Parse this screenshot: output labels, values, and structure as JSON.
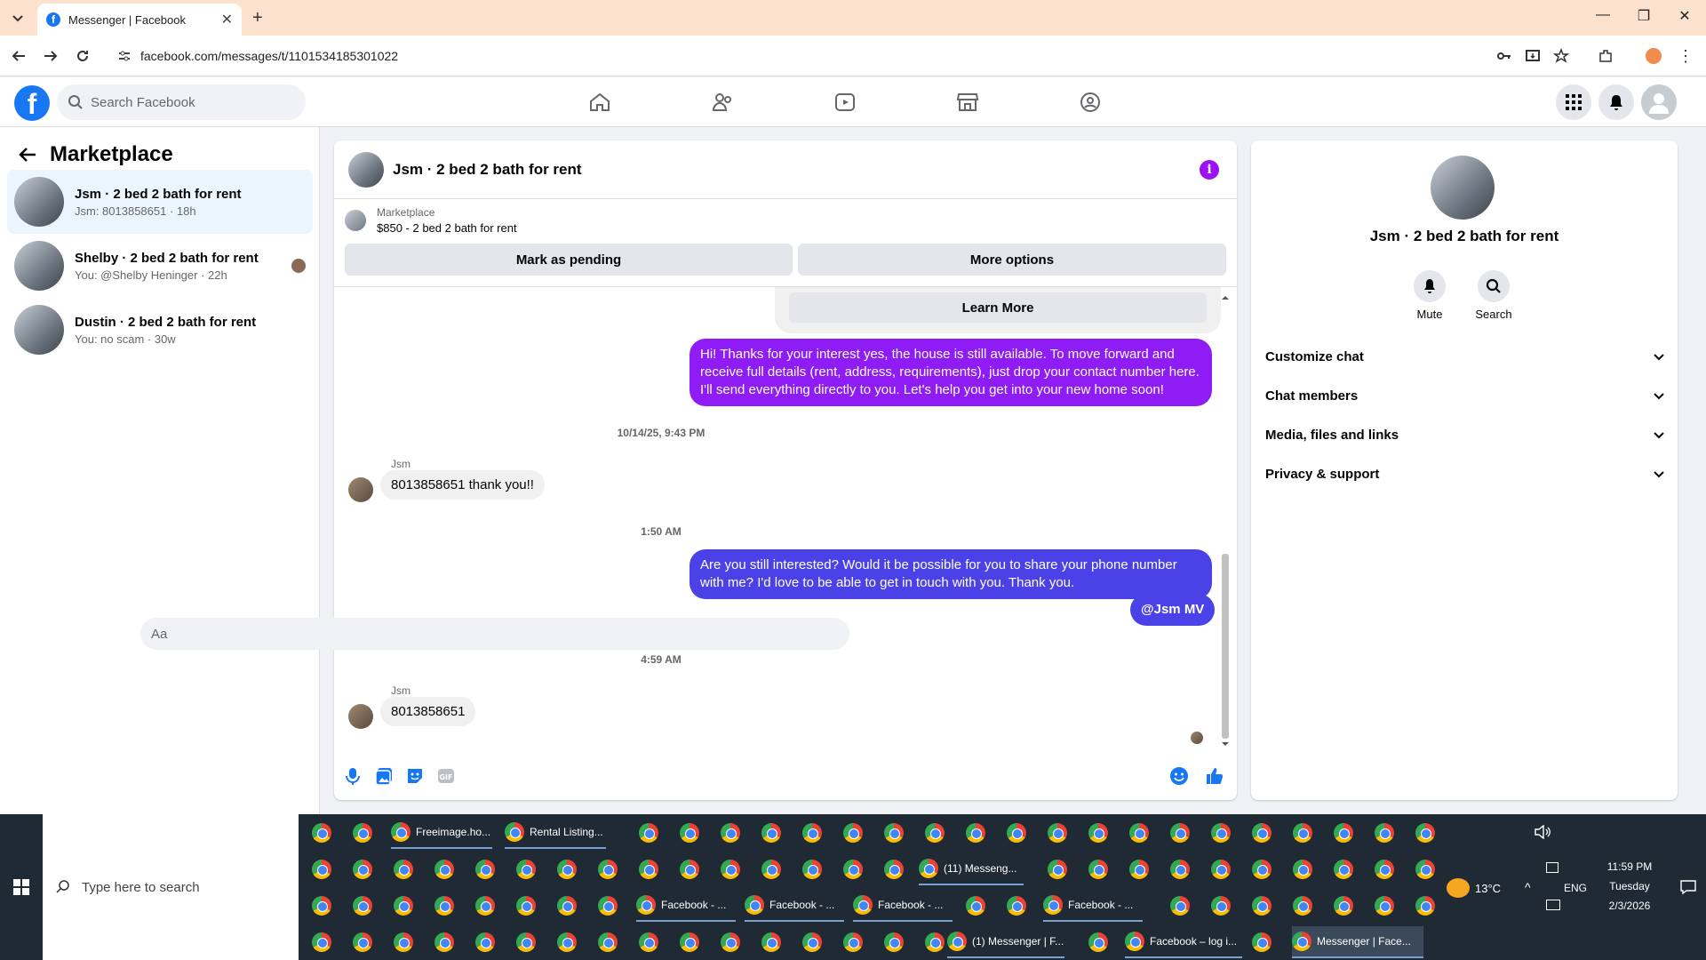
{
  "browser": {
    "tab_title": "Messenger | Facebook",
    "url": "facebook.com/messages/t/1101534185301022"
  },
  "fb": {
    "search_placeholder": "Search Facebook"
  },
  "left": {
    "title": "Marketplace",
    "conversations": [
      {
        "name": "Jsm · 2 bed 2 bath for rent",
        "sub": "Jsm: 8013858651 · 18h"
      },
      {
        "name": "Shelby · 2 bed 2 bath for rent",
        "sub": "You: @Shelby Heninger · 22h"
      },
      {
        "name": "Dustin · 2 bed 2 bath for rent",
        "sub": "You: no scam · 30w"
      }
    ]
  },
  "chat": {
    "title": "Jsm · 2 bed 2 bath for rent",
    "marketplace_label": "Marketplace",
    "listing": "$850 - 2 bed 2 bath for rent",
    "mark_pending": "Mark as pending",
    "more_options": "More options",
    "learn_more": "Learn More",
    "messages": {
      "out1": "Hi! Thanks for your interest yes, the house is still available. To move forward and receive full details (rent, address, requirements), just drop your contact number here. I'll send everything directly to you. Let's help you get into your new home soon!",
      "ts1": "10/14/25, 9:43 PM",
      "sender1": "Jsm",
      "in1": "8013858651 thank you!!",
      "ts2": "1:50 AM",
      "out2": "Are you still interested? Would it be possible for you to share your phone number with me? I'd love to be able to get in touch with you. Thank you.",
      "mention": "@Jsm MV",
      "ts3": "4:59 AM",
      "sender2": "Jsm",
      "in2": "8013858651"
    },
    "composer_placeholder": "Aa"
  },
  "right": {
    "title": "Jsm · 2 bed 2 bath for rent",
    "mute": "Mute",
    "search": "Search",
    "sections": [
      "Customize chat",
      "Chat members",
      "Media, files and links",
      "Privacy & support"
    ]
  },
  "taskbar": {
    "search_placeholder": "Type here to search",
    "labeled": [
      "Freeimage.ho...",
      "Rental Listing...",
      "(11) Messeng...",
      "Facebook - ...",
      "Facebook - ...",
      "Facebook - ...",
      "Facebook - ...",
      "(1) Messenger | F...",
      "Facebook – log i...",
      "Messenger | Face..."
    ],
    "weather": "13°C",
    "lang": "ENG",
    "time": "11:59 PM",
    "day": "Tuesday",
    "date": "2/3/2026"
  },
  "colors": {
    "accent": "#1877f2",
    "outgoing": "#8f1bf5",
    "outgoing2": "#4a41e6"
  }
}
